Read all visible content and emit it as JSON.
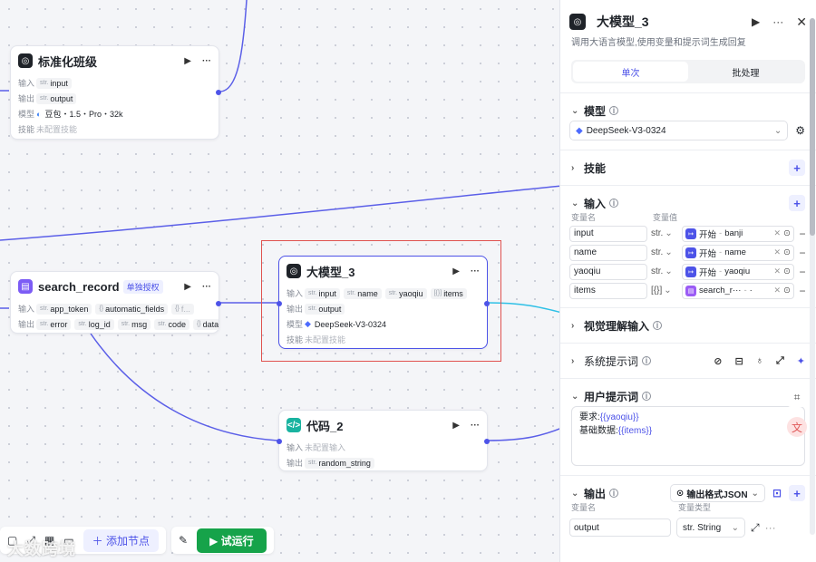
{
  "nodes": {
    "standardize": {
      "title": "标准化班级",
      "input_label": "输入",
      "output_label": "输出",
      "model_label": "模型",
      "skill_label": "技能",
      "input_type": "str.",
      "input_name": "input",
      "output_type": "str.",
      "output_name": "output",
      "model_value": "豆包・1.5・Pro・32k",
      "skill_value": "未配置技能"
    },
    "search_record": {
      "title": "search_record",
      "badge": "单独授权",
      "input_label": "输入",
      "output_label": "输出",
      "inputs": [
        {
          "type": "str.",
          "name": "app_token"
        },
        {
          "type": "{}",
          "name": "automatic_fields"
        },
        {
          "type": "{}",
          "name": "f..."
        }
      ],
      "outputs": [
        {
          "type": "str.",
          "name": "error"
        },
        {
          "type": "str.",
          "name": "log_id"
        },
        {
          "type": "str.",
          "name": "msg"
        },
        {
          "type": "str.",
          "name": "code"
        },
        {
          "type": "{}",
          "name": "data"
        }
      ]
    },
    "llm3": {
      "title": "大模型_3",
      "input_label": "输入",
      "output_label": "输出",
      "model_label": "模型",
      "skill_label": "技能",
      "inputs": [
        {
          "type": "str.",
          "name": "input"
        },
        {
          "type": "str.",
          "name": "name"
        },
        {
          "type": "str.",
          "name": "yaoqiu"
        },
        {
          "type": "[{}]",
          "name": "items"
        }
      ],
      "output_type": "str.",
      "output_name": "output",
      "model_value": "DeepSeek-V3-0324",
      "skill_value": "未配置技能"
    },
    "code2": {
      "title": "代码_2",
      "input_label": "输入",
      "output_label": "输出",
      "input_value": "未配置输入",
      "output_type": "str.",
      "output_name": "random_string"
    }
  },
  "toolbar": {
    "add_node": "添加节点",
    "run": "试运行"
  },
  "watermark": "大数跨境",
  "panel": {
    "title": "大模型_3",
    "description": "调用大语言模型,使用变量和提示词生成回复",
    "tabs": [
      {
        "label": "单次"
      },
      {
        "label": "批处理"
      }
    ],
    "model_section": "模型",
    "model_value": "DeepSeek-V3-0324",
    "skills_section": "技能",
    "input_section": "输入",
    "col_var_name": "变量名",
    "col_var_value": "变量值",
    "vars": [
      {
        "name": "input",
        "type": "str.",
        "source": "开始",
        "ref": "banji"
      },
      {
        "name": "name",
        "type": "str.",
        "source": "开始",
        "ref": "name"
      },
      {
        "name": "yaoqiu",
        "type": "str.",
        "source": "开始",
        "ref": "yaoqiu"
      },
      {
        "name": "items",
        "type": "[{}]",
        "source": "search_r···",
        "ref": "·"
      }
    ],
    "vision_section": "视觉理解输入",
    "system_prompt_section": "系统提示词",
    "user_prompt_section": "用户提示词",
    "user_prompt": {
      "line1_label": "要求:",
      "line1_var": "{{yaoqiu}}",
      "line2_label": "基础数据:",
      "line2_var": "{{items}}"
    },
    "output_section": "输出",
    "output_format": "输出格式JSON",
    "out_col_name": "变量名",
    "out_col_type": "变量类型",
    "output_var": {
      "name": "output",
      "type": "str. String"
    }
  },
  "colors": {
    "accent": "#4d53e8",
    "run": "#16a34a",
    "selection": "#e0524f",
    "edge": "#5b5fe8",
    "edge_alt": "#2fc0e6"
  }
}
